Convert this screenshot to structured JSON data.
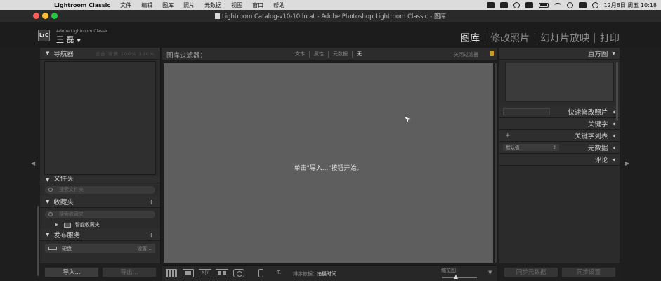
{
  "menubar": {
    "apple_glyph": "",
    "app_name": "Lightroom Classic",
    "menus": [
      "文件",
      "编辑",
      "图库",
      "照片",
      "元数据",
      "视图",
      "窗口",
      "帮助"
    ],
    "datetime": "12月8日 周五 10:18"
  },
  "window": {
    "title": "Lightroom Catalog-v10-10.lrcat - Adobe Photoshop Lightroom Classic - 图库"
  },
  "identity": {
    "logo_text": "LrC",
    "caption": "Adobe Lightroom Classic",
    "user": "王 磊",
    "user_caret": "▼"
  },
  "modules": [
    {
      "label": "图库",
      "active": true
    },
    {
      "label": "修改照片",
      "active": false
    },
    {
      "label": "幻灯片放映",
      "active": false
    },
    {
      "label": "打印",
      "active": false
    }
  ],
  "left_panel": {
    "navigator": {
      "title": "导航器",
      "zoom_labels": "适合  填满  100%  300%"
    },
    "folders": {
      "title": "文件夹",
      "search_placeholder": "搜索文件夹"
    },
    "collections": {
      "title": "收藏夹",
      "search_placeholder": "搜索收藏夹",
      "items": [
        {
          "label": "智能收藏夹"
        }
      ]
    },
    "publish": {
      "title": "发布服务",
      "services": [
        {
          "label": "硬盘",
          "setting": "设置..."
        }
      ]
    },
    "buttons": {
      "import": "导入...",
      "export": "导出..."
    }
  },
  "center": {
    "filter_bar": {
      "label": "图库过滤器：",
      "tabs": [
        "文本",
        "属性",
        "元数据",
        "无"
      ],
      "off_label": "关闭过滤器"
    },
    "empty_message": "单击\"导入...\"按钮开始。",
    "toolbar": {
      "compare_text": "X|Y",
      "sort_label": "排序依据：",
      "sort_value": "拍摄时间",
      "thumbnail_label": "缩览图",
      "thumbnail_size": 0.4
    }
  },
  "right_panel": {
    "histogram": {
      "title": "直方图"
    },
    "quick_develop": {
      "title": "快速修改照片"
    },
    "keywording": {
      "title": "关键字"
    },
    "keyword_list": {
      "title": "关键字列表",
      "add_glyph": "+"
    },
    "metadata": {
      "title": "元数据",
      "preset": "默认值"
    },
    "comments": {
      "title": "评论"
    },
    "buttons": {
      "sync_metadata": "同步元数据",
      "sync_settings": "同步设置"
    }
  }
}
